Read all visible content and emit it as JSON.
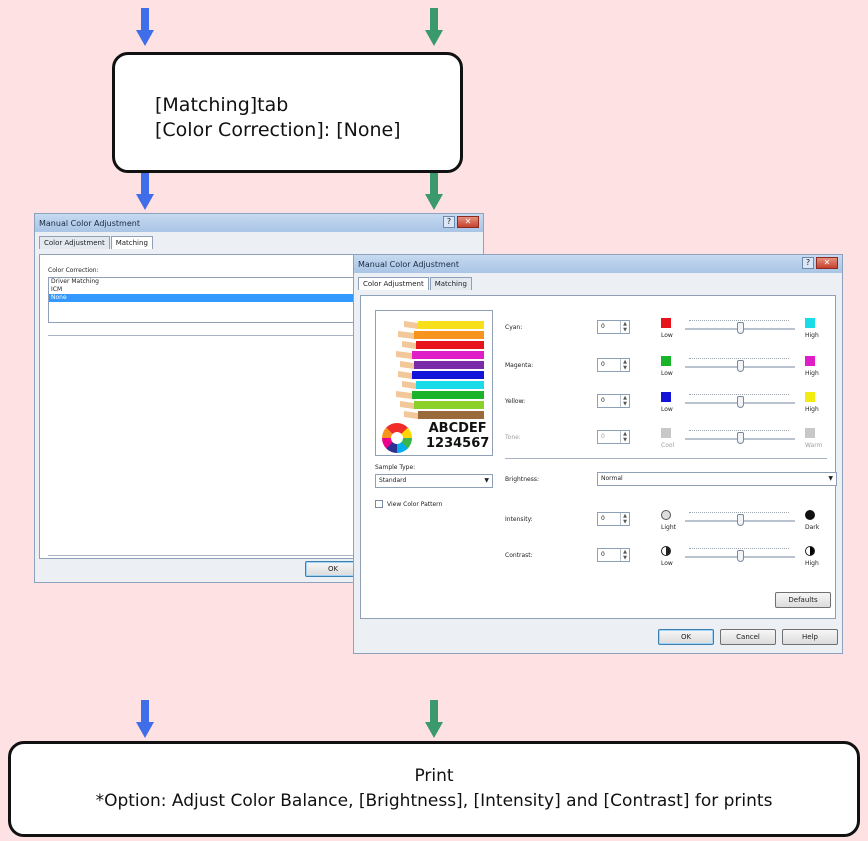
{
  "colors": {
    "blue_arrow": "#3f6ee8",
    "green_arrow": "#3a9a6e",
    "background": "#fde1e3"
  },
  "box1": {
    "line1": "[Matching]tab",
    "line2": "[Color Correction]: [None]"
  },
  "box2": {
    "line1": "Print",
    "line2": "*Option: Adjust Color Balance, [Brightness], [Intensity] and [Contrast] for prints"
  },
  "window_back": {
    "title": "Manual Color Adjustment",
    "tabs": [
      "Color Adjustment",
      "Matching"
    ],
    "color_correction_label": "Color Correction:",
    "options": [
      "Driver Matching",
      "ICM",
      "None"
    ],
    "selected_option": "None",
    "ok_label": "OK"
  },
  "window_front": {
    "title": "Manual Color Adjustment",
    "tabs": [
      "Color Adjustment",
      "Matching"
    ],
    "sample_text1": "ABCDEF",
    "sample_text2": "1234567",
    "sample_type_label": "Sample Type:",
    "sample_type_value": "Standard",
    "view_color_pattern_label": "View Color Pattern",
    "sliders": [
      {
        "label": "Cyan:",
        "value": "0",
        "low": "Low",
        "high": "High",
        "low_color": "#e8141c",
        "high_color": "#1adbe8",
        "enabled": true
      },
      {
        "label": "Magenta:",
        "value": "0",
        "low": "Low",
        "high": "High",
        "low_color": "#19b42a",
        "high_color": "#e01ec8",
        "enabled": true
      },
      {
        "label": "Yellow:",
        "value": "0",
        "low": "Low",
        "high": "High",
        "low_color": "#1414d8",
        "high_color": "#f2ec12",
        "enabled": true
      },
      {
        "label": "Tone:",
        "value": "0",
        "low": "Cool",
        "high": "Warm",
        "low_color": "#c8c8c8",
        "high_color": "#c8c8c8",
        "enabled": false
      }
    ],
    "brightness_label": "Brightness:",
    "brightness_value": "Normal",
    "intensity": {
      "label": "Intensity:",
      "value": "0",
      "low": "Light",
      "high": "Dark"
    },
    "contrast": {
      "label": "Contrast:",
      "value": "0",
      "low": "Low",
      "high": "High"
    },
    "defaults_label": "Defaults",
    "ok_label": "OK",
    "cancel_label": "Cancel",
    "help_label": "Help"
  }
}
